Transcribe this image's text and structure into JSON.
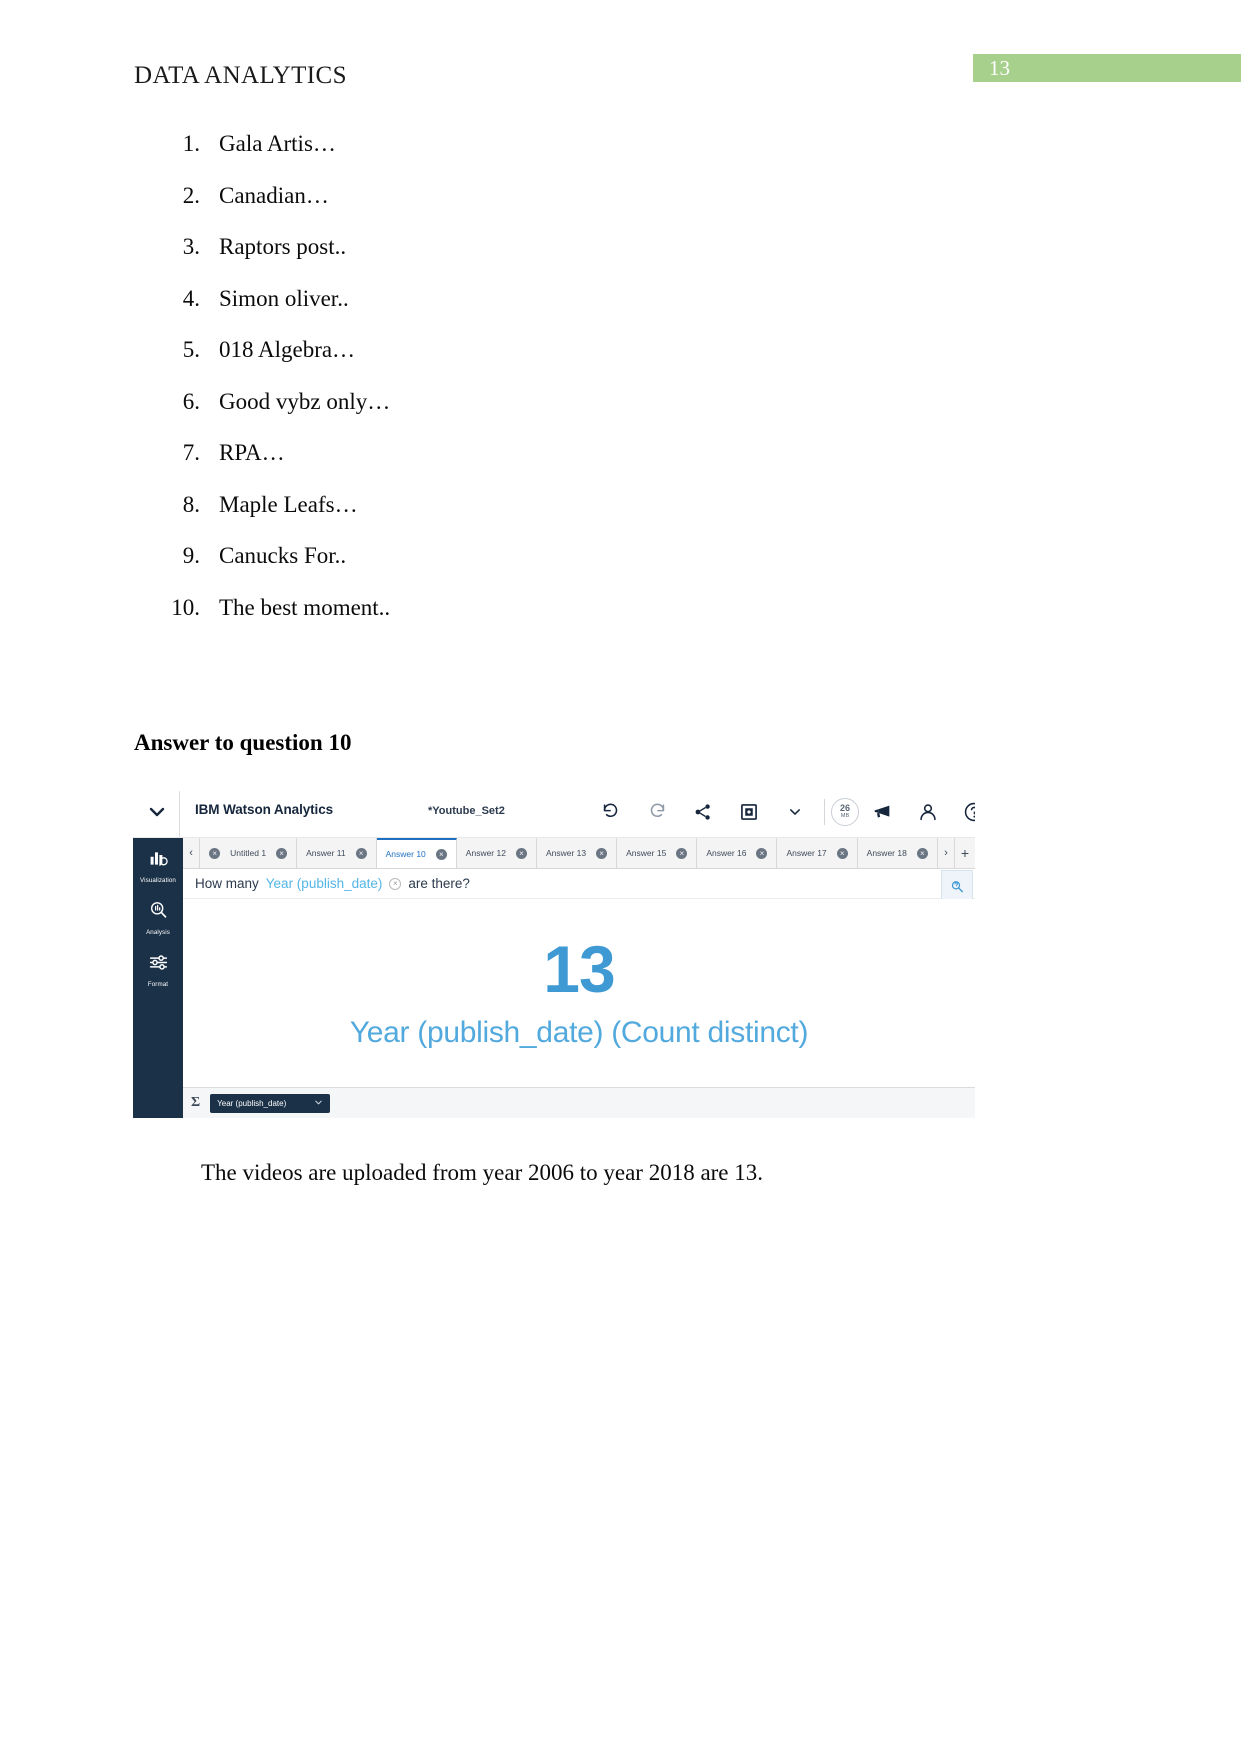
{
  "header": {
    "doc_title": "DATA ANALYTICS",
    "page_number": "13",
    "badge_color": "#a8d08d"
  },
  "list": {
    "items": [
      {
        "marker": "1.",
        "text": "Gala Artis…"
      },
      {
        "marker": "2.",
        "text": "Canadian…"
      },
      {
        "marker": "3.",
        "text": "Raptors post.."
      },
      {
        "marker": "4.",
        "text": "Simon oliver.."
      },
      {
        "marker": "5.",
        "text": "018 Algebra…"
      },
      {
        "marker": "6.",
        "text": "Good vybz only…"
      },
      {
        "marker": "7.",
        "text": "RPA…"
      },
      {
        "marker": "8.",
        "text": "Maple Leafs…"
      },
      {
        "marker": "9.",
        "text": "Canucks For.."
      },
      {
        "marker": "10.",
        "text": "The best moment.."
      }
    ]
  },
  "answer_heading": "Answer to question 10",
  "app": {
    "brand": "IBM Watson Analytics",
    "dataset": "*Youtube_Set2",
    "topbar_icons": [
      {
        "name": "undo-icon",
        "label": "Undo"
      },
      {
        "name": "redo-icon",
        "label": "Redo"
      },
      {
        "name": "share-icon",
        "label": "Share"
      },
      {
        "name": "save-icon",
        "label": "Save"
      },
      {
        "name": "chevron-down-icon",
        "label": "More save options"
      },
      {
        "name": "megaphone-icon",
        "label": "Announcements"
      },
      {
        "name": "user-icon",
        "label": "Account"
      },
      {
        "name": "help-icon",
        "label": "Help"
      }
    ],
    "storage": {
      "amount": "26",
      "unit": "MB"
    },
    "rail": [
      {
        "name": "visualization",
        "label": "Visualization"
      },
      {
        "name": "analysis",
        "label": "Analysis"
      },
      {
        "name": "format",
        "label": "Format"
      }
    ],
    "tabs": [
      {
        "label": "Untitled 1",
        "active": false
      },
      {
        "label": "Answer 11",
        "active": false
      },
      {
        "label": "Answer 10",
        "active": true
      },
      {
        "label": "Answer 12",
        "active": false
      },
      {
        "label": "Answer 13",
        "active": false
      },
      {
        "label": "Answer 15",
        "active": false
      },
      {
        "label": "Answer 16",
        "active": false
      },
      {
        "label": "Answer 17",
        "active": false
      },
      {
        "label": "Answer 18",
        "active": false
      }
    ],
    "tab_prev_icon": "‹",
    "tab_next_icon": "›",
    "tab_add_icon": "+",
    "tab_close_icon": "×",
    "question": {
      "prefix": "How many",
      "token": "Year (publish_date)",
      "token_close": "×",
      "suffix": "are there?"
    },
    "visualization": {
      "value": "13",
      "caption": "Year (publish_date) (Count distinct)",
      "value_color": "#3f9ad4",
      "caption_color": "#52a9dd"
    },
    "databar": {
      "sigma": "Σ",
      "pill_label": "Year (publish_date)",
      "pill_chevron": "⌄"
    }
  },
  "closing_text": "The videos are uploaded from year 2006 to year 2018 are 13.",
  "chart_data": {
    "type": "table",
    "title": "Year (publish_date) (Count distinct)",
    "categories": [
      "Year (publish_date) (Count distinct)"
    ],
    "values": [
      13
    ],
    "xlabel": "",
    "ylabel": "",
    "annotations": [
      "The videos are uploaded from year 2006 to year 2018 are 13."
    ]
  }
}
